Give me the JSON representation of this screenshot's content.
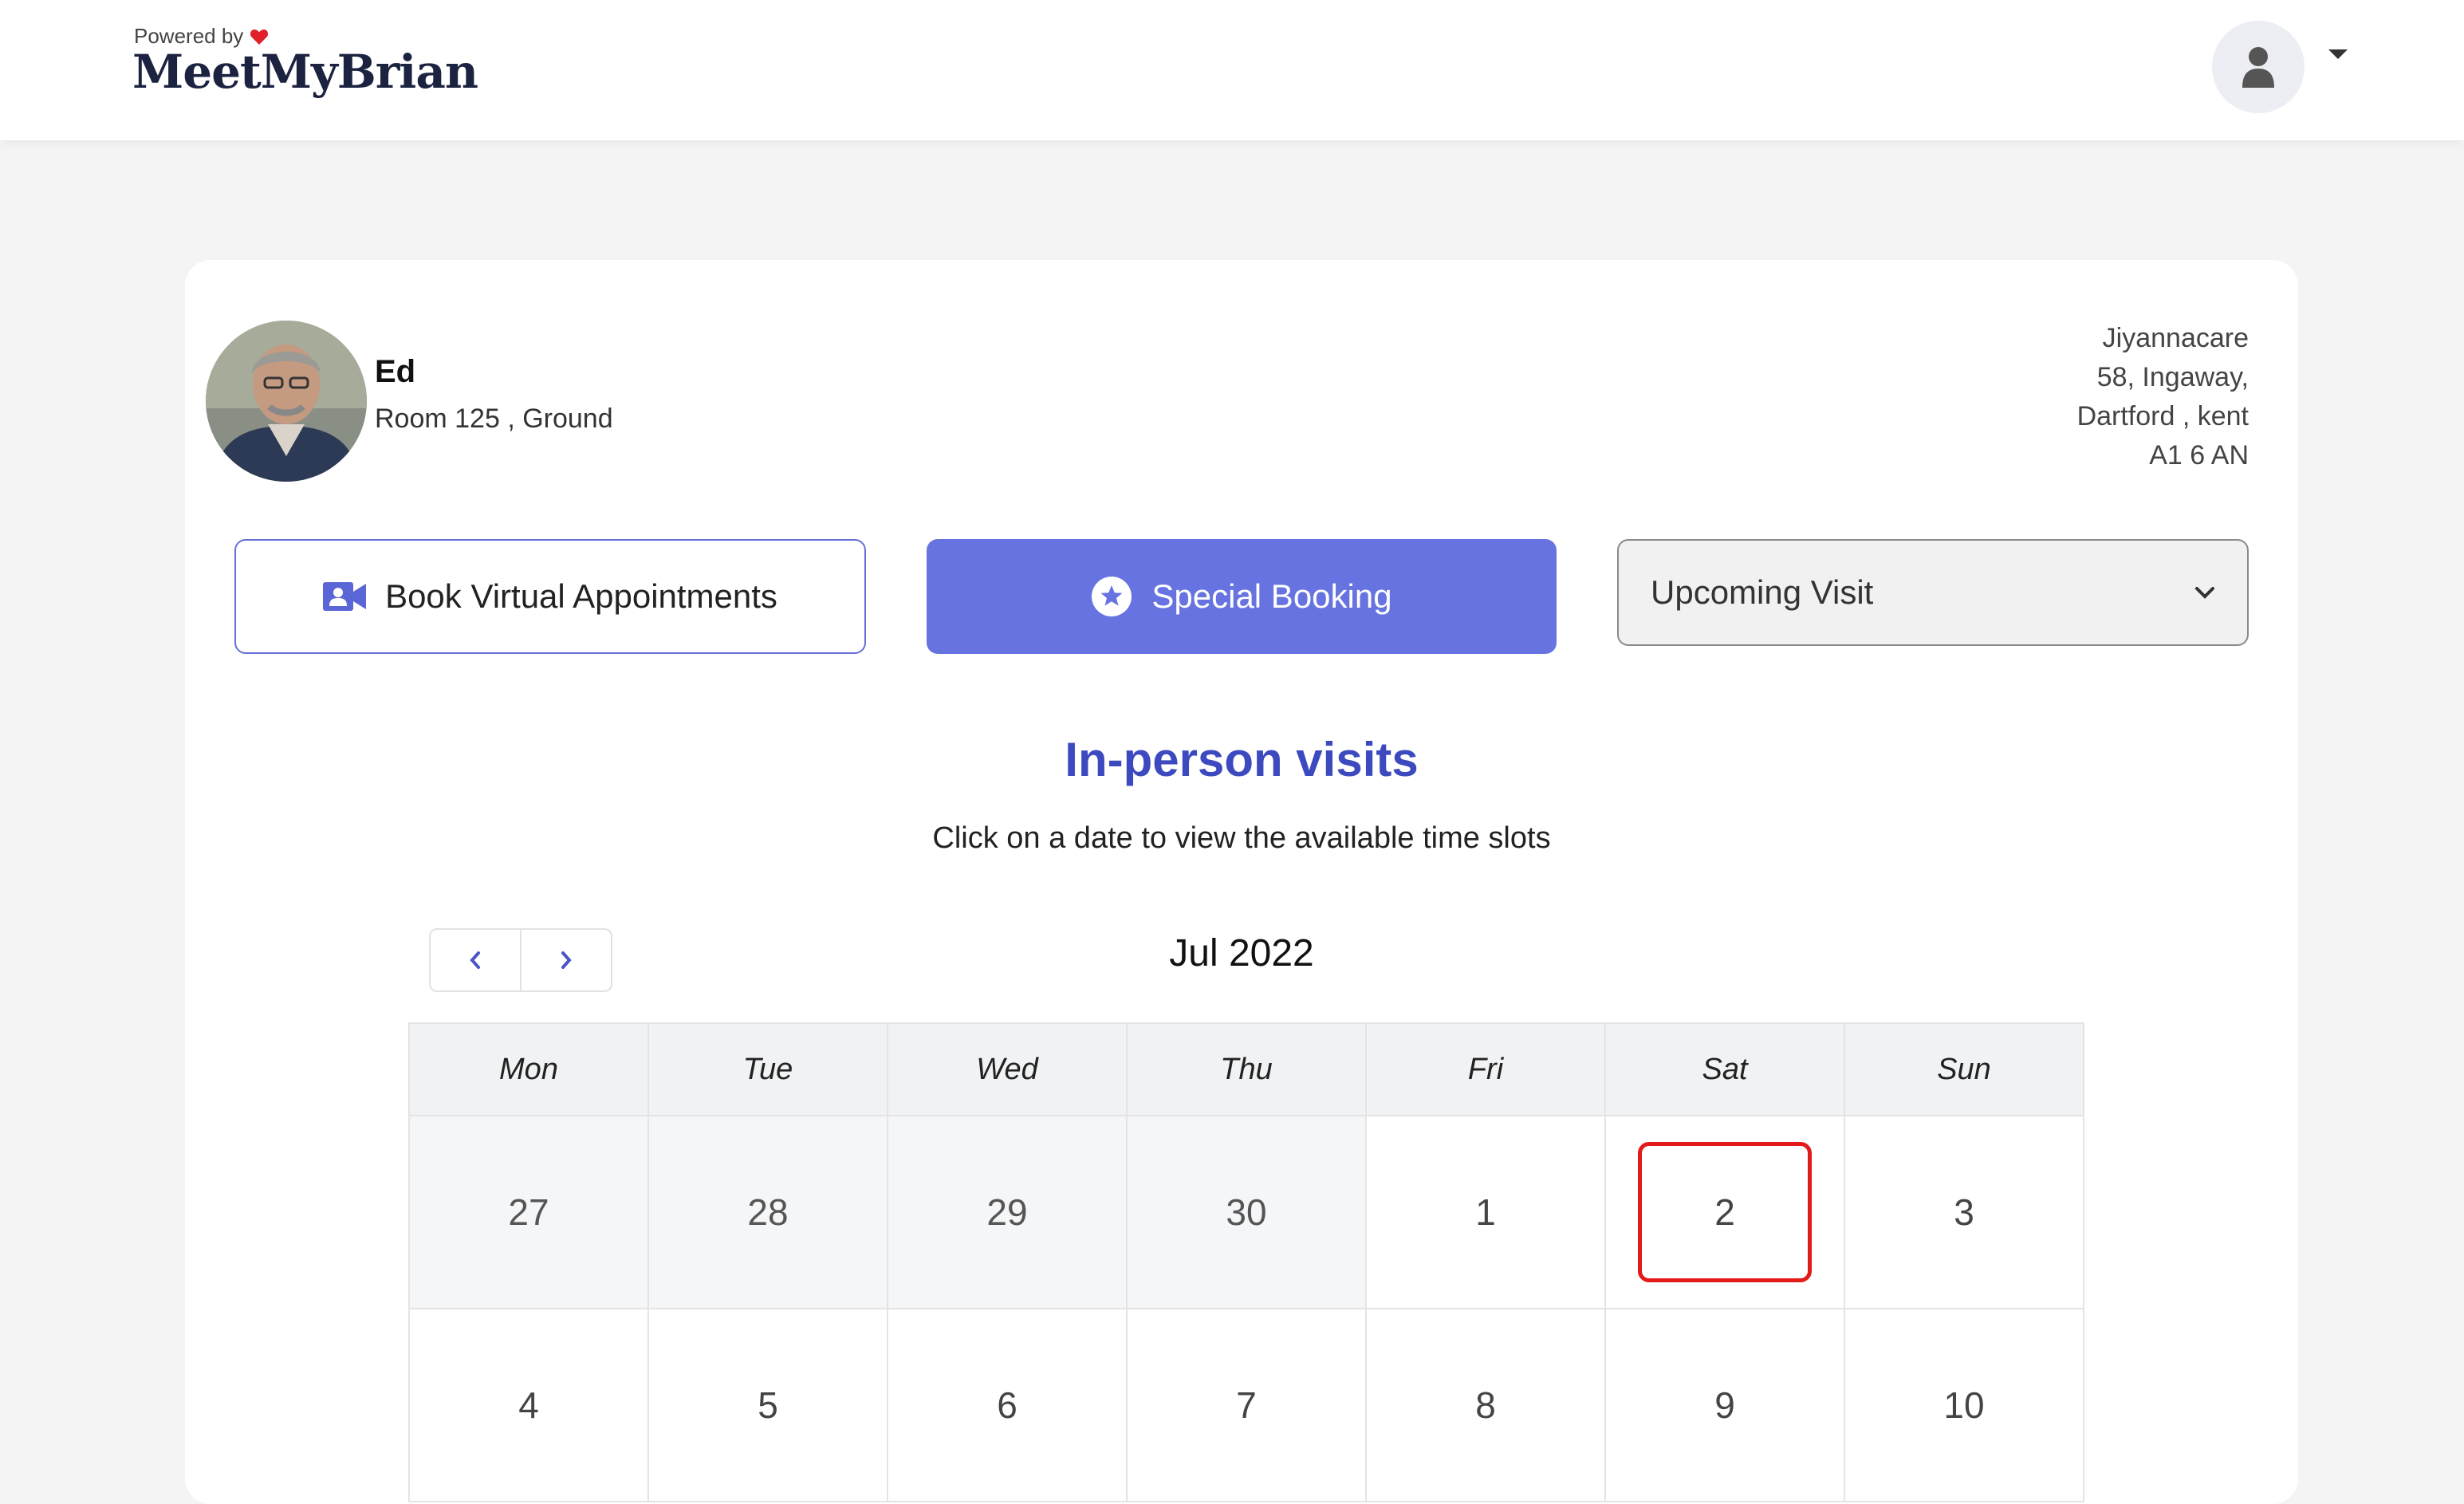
{
  "header": {
    "powered_by": "Powered by",
    "brand": "MeetMyBrian"
  },
  "resident": {
    "name": "Ed",
    "room": "Room 125 , Ground"
  },
  "address": {
    "line1": "Jiyannacare",
    "line2": "58, Ingaway,",
    "line3": "Dartford , kent",
    "line4": "A1 6 AN"
  },
  "actions": {
    "virtual_label": "Book Virtual Appointments",
    "special_label": "Special Booking",
    "visit_select": "Upcoming Visit"
  },
  "section": {
    "title": "In-person visits",
    "subtitle": "Click on a date to view the available time slots"
  },
  "calendar": {
    "month": "Jul 2022",
    "weekdays": [
      "Mon",
      "Tue",
      "Wed",
      "Thu",
      "Fri",
      "Sat",
      "Sun"
    ],
    "weeks": [
      [
        "27",
        "28",
        "29",
        "30",
        "1",
        "2",
        "3"
      ],
      [
        "4",
        "5",
        "6",
        "7",
        "8",
        "9",
        "10"
      ]
    ],
    "selected_day": "2"
  },
  "colors": {
    "accent": "#6673e0",
    "title": "#3d4abf",
    "selected_border": "#e21a1a"
  }
}
